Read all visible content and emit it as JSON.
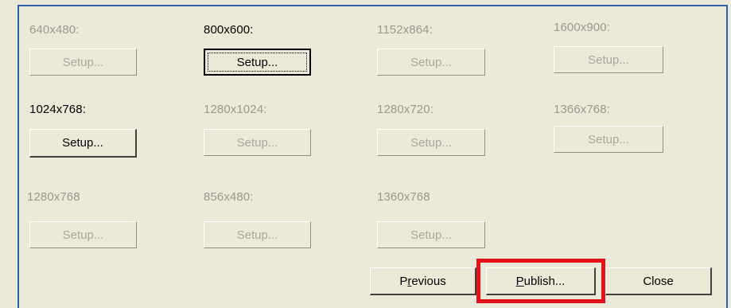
{
  "resolutions": [
    {
      "label": "640x480:",
      "button": "Setup...",
      "enabled": false
    },
    {
      "label": "800x600:",
      "button": "Setup...",
      "enabled": true
    },
    {
      "label": "1152x864:",
      "button": "Setup...",
      "enabled": false
    },
    {
      "label": "1600x900:",
      "button": "Setup...",
      "enabled": false
    },
    {
      "label": "1024x768:",
      "button": "Setup...",
      "enabled": true
    },
    {
      "label": "1280x1024:",
      "button": "Setup...",
      "enabled": false
    },
    {
      "label": "1280x720:",
      "button": "Setup...",
      "enabled": false
    },
    {
      "label": "1366x768:",
      "button": "Setup...",
      "enabled": false
    },
    {
      "label": "1280x768",
      "button": "Setup...",
      "enabled": false
    },
    {
      "label": "856x480:",
      "button": "Setup...",
      "enabled": false
    },
    {
      "label": "1360x768",
      "button": "Setup...",
      "enabled": false
    }
  ],
  "actions": {
    "previous_prefix": "P",
    "previous_mnemonic": "r",
    "previous_rest": "evious",
    "publish_mnemonic": "P",
    "publish_rest": "ublish...",
    "close_label": "Close"
  },
  "colors": {
    "highlight": "#e3121b",
    "dialog_border": "#2f5fa8",
    "background": "#ece9d8"
  }
}
